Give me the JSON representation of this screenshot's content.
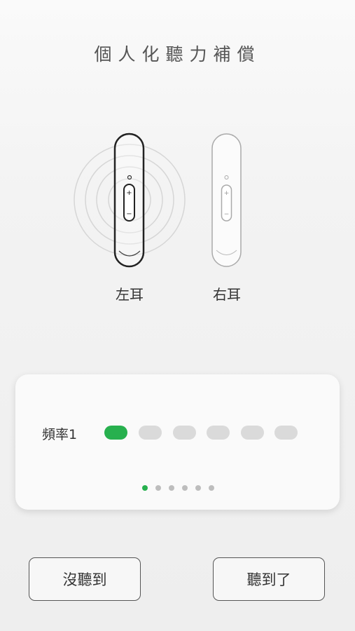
{
  "header": {
    "title": "個人化聽力補償"
  },
  "earpieces": {
    "left": {
      "label": "左耳",
      "selected": true
    },
    "right": {
      "label": "右耳",
      "selected": false
    }
  },
  "frequency_panel": {
    "label": "頻率1",
    "total_steps": 6,
    "current_step": 1,
    "accent_color": "#27b04e",
    "inactive_color": "#dadada",
    "page_dots_total": 6,
    "page_dots_current": 1
  },
  "actions": {
    "not_heard_label": "沒聽到",
    "heard_label": "聽到了"
  }
}
